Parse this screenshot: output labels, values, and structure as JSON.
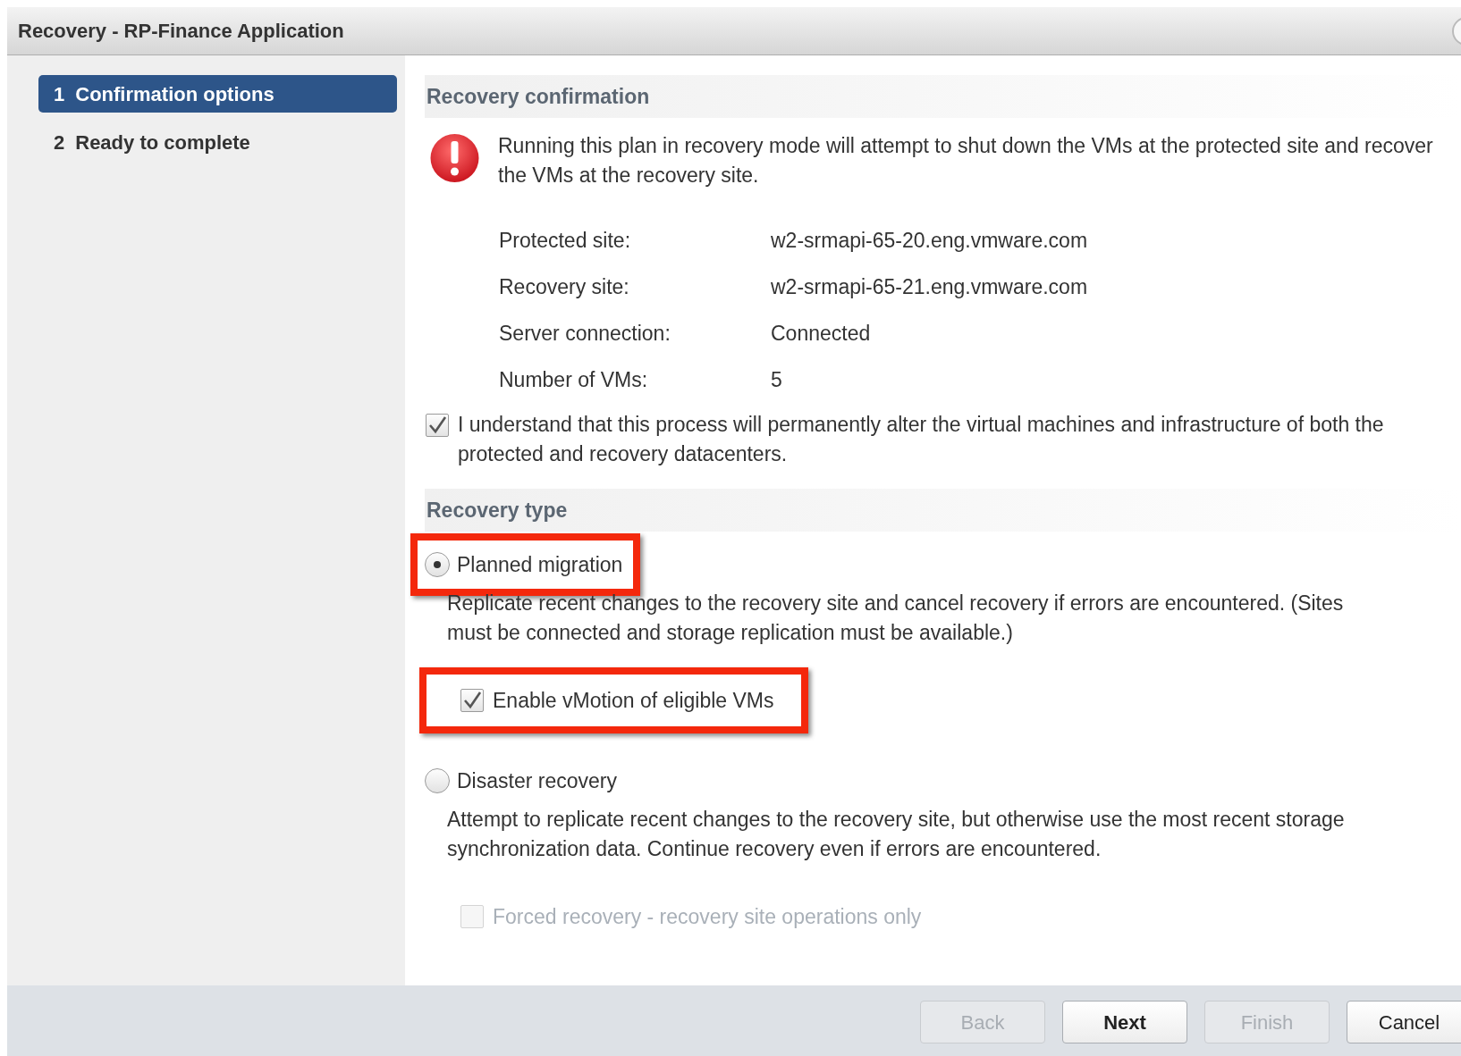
{
  "window": {
    "title": "Recovery - RP-Finance Application"
  },
  "steps": [
    {
      "number": "1",
      "label": "Confirmation options",
      "selected": true
    },
    {
      "number": "2",
      "label": "Ready to complete",
      "selected": false
    }
  ],
  "confirmation": {
    "heading": "Recovery confirmation",
    "warning": "Running this plan in recovery mode will attempt to shut down the VMs at the protected site and recover the VMs at the recovery site.",
    "properties": [
      {
        "label": "Protected site:",
        "value": "w2-srmapi-65-20.eng.vmware.com"
      },
      {
        "label": "Recovery site:",
        "value": "w2-srmapi-65-21.eng.vmware.com"
      },
      {
        "label": "Server connection:",
        "value": "Connected"
      },
      {
        "label": "Number of VMs:",
        "value": "5"
      }
    ],
    "acknowledge": {
      "label": "I understand that this process will permanently alter the virtual machines and infrastructure of both the protected and recovery datacenters.",
      "checked": true
    }
  },
  "recovery_type": {
    "heading": "Recovery type",
    "options": [
      {
        "label": "Planned migration",
        "selected": true,
        "highlighted": true,
        "description": "Replicate recent changes to the recovery site and cancel recovery if errors are encountered. (Sites must be connected and storage replication must be available.)",
        "suboption": {
          "label": "Enable vMotion of eligible VMs",
          "checked": true,
          "disabled": false,
          "highlighted": true
        }
      },
      {
        "label": "Disaster recovery",
        "selected": false,
        "highlighted": false,
        "description": "Attempt to replicate recent changes to the recovery site, but otherwise use the most recent storage synchronization data. Continue recovery even if errors are encountered.",
        "suboption": {
          "label": "Forced recovery - recovery site operations only",
          "checked": false,
          "disabled": true,
          "highlighted": false
        }
      }
    ]
  },
  "buttons": [
    {
      "label": "Back",
      "disabled": true,
      "default": false
    },
    {
      "label": "Next",
      "disabled": false,
      "default": true
    },
    {
      "label": "Finish",
      "disabled": true,
      "default": false
    },
    {
      "label": "Cancel",
      "disabled": false,
      "default": false
    }
  ]
}
